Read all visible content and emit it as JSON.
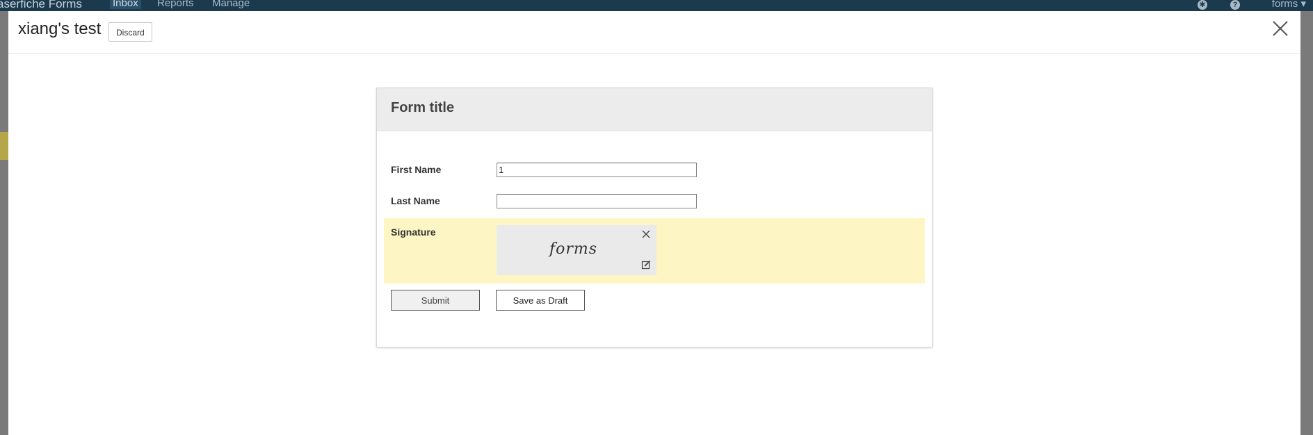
{
  "app": {
    "brand": "aserfiche Forms",
    "nav": [
      "Inbox",
      "Reports",
      "Manage"
    ],
    "user": "forms ▾"
  },
  "modal": {
    "title": "xiang's test",
    "discard_label": "Discard"
  },
  "form": {
    "title": "Form title",
    "fields": [
      {
        "label": "First Name",
        "value": "1"
      },
      {
        "label": "Last Name",
        "value": ""
      }
    ],
    "signature": {
      "label": "Signature",
      "value": "forms",
      "highlight_color": "#fdf6c4"
    },
    "submit_label": "Submit",
    "draft_label": "Save as Draft"
  },
  "colors": {
    "topbar": "#1b3a4e",
    "overlay": "#7a7a7a",
    "form_header": "#ececec"
  }
}
